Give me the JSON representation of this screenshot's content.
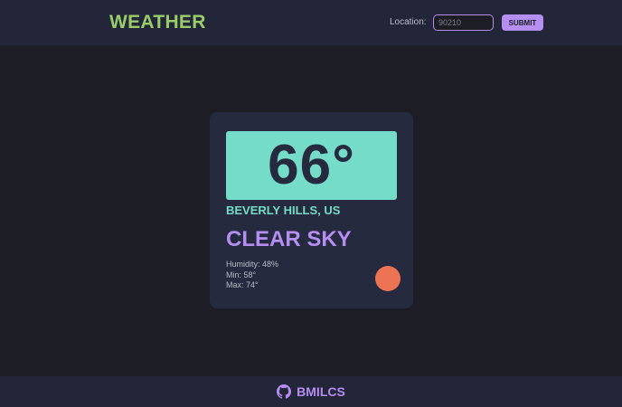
{
  "colors": {
    "brand": "#9acd6a",
    "accent_purple": "#b58ef2",
    "accent_teal": "#74dcc8",
    "sun": "#ed7355"
  },
  "header": {
    "brand": "WEATHER",
    "location_label": "Location:",
    "location_placeholder": "90210",
    "location_value": "",
    "submit_label": "SUBMIT"
  },
  "weather": {
    "temperature": "66°",
    "city": "BEVERLY HILLS, US",
    "condition": "CLEAR SKY",
    "humidity": "Humidity: 48%",
    "min": "Min: 58°",
    "max": "Max: 74°",
    "condition_icon": "sun-icon"
  },
  "footer": {
    "icon": "github-icon",
    "text": "BMILCS"
  }
}
